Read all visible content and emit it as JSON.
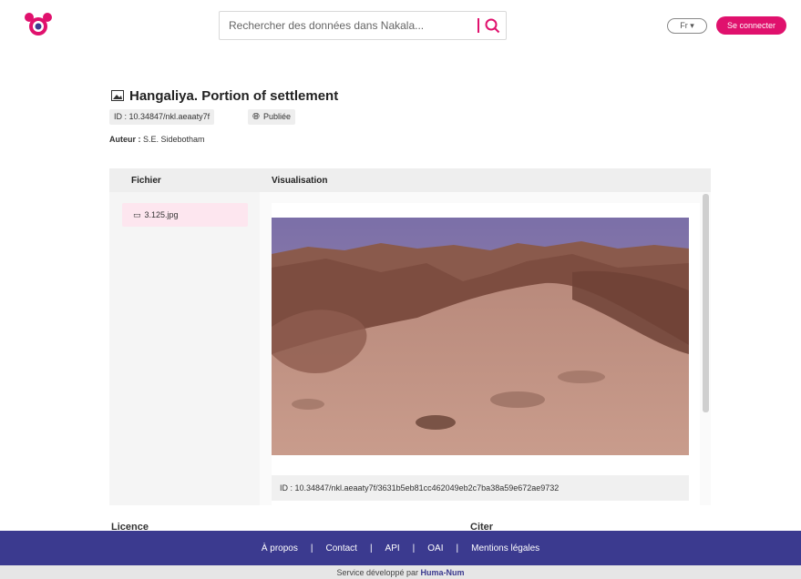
{
  "header": {
    "search_placeholder": "Rechercher des données dans Nakala...",
    "language": "Fr ▾",
    "login_label": "Se connecter"
  },
  "record": {
    "title": "Hangaliya. Portion of settlement",
    "id_badge": "ID : 10.34847/nkl.aeaaty7f",
    "status_badge": "Publiée",
    "author_label": "Auteur :",
    "author_name": "S.E. Sidebotham"
  },
  "panel": {
    "files_header": "Fichier",
    "viewer_header": "Visualisation",
    "files": [
      {
        "name": "3.125.jpg"
      }
    ],
    "file_id": "ID : 10.34847/nkl.aeaaty7f/3631b5eb81cc462049eb2c7ba38a59e672ae9732"
  },
  "sections": {
    "left": "Licence",
    "right": "Citer"
  },
  "footer": {
    "links": [
      "À propos",
      "Contact",
      "API",
      "OAI",
      "Mentions légales"
    ],
    "separator": "|",
    "credit_prefix": "Service développé par",
    "credit_name": "Huma-Num"
  },
  "colors": {
    "accent": "#e0116d",
    "footer_bg": "#3b3a8f"
  }
}
